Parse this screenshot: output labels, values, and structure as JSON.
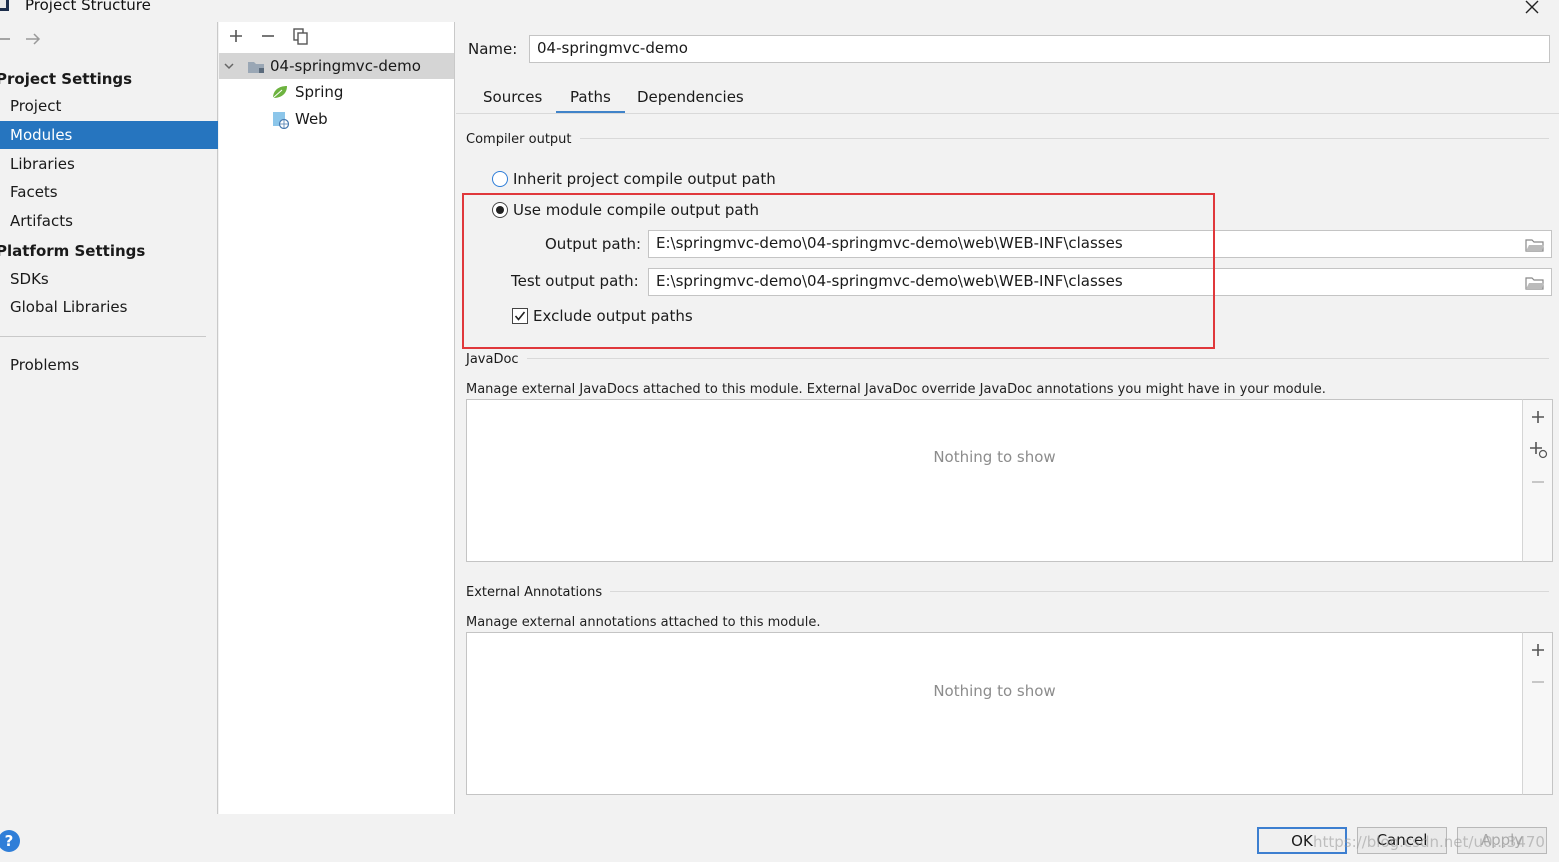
{
  "window": {
    "title": "Project Structure"
  },
  "colors": {
    "selection": "#2675bf",
    "tab_underline": "#4083c9",
    "highlight_box": "#e0383b",
    "spring_leaf": "#6db33f"
  },
  "icons": [
    "app-icon",
    "close-icon",
    "back-arrow-icon",
    "forward-arrow-icon",
    "add-icon",
    "remove-icon",
    "copy-icon",
    "chevron-down-icon",
    "module-folder-icon",
    "spring-icon",
    "web-icon",
    "folder-icon",
    "add-module-icon",
    "help-icon"
  ],
  "left_panel": {
    "project_settings_heading": "Project Settings",
    "project_items": [
      "Project",
      "Modules",
      "Libraries",
      "Facets",
      "Artifacts"
    ],
    "selected_item": "Modules",
    "platform_settings_heading": "Platform Settings",
    "platform_items": [
      "SDKs",
      "Global Libraries"
    ],
    "problems": "Problems"
  },
  "tree": {
    "root": "04-springmvc-demo",
    "children": [
      "Spring",
      "Web"
    ]
  },
  "detail": {
    "name_label": "Name:",
    "name_value": "04-springmvc-demo",
    "tabs": [
      "Sources",
      "Paths",
      "Dependencies"
    ],
    "active_tab": "Paths",
    "compiler_output": {
      "title": "Compiler output",
      "inherit_label": "Inherit project compile output path",
      "use_module_label": "Use module compile output path",
      "selected": "Use module compile output path",
      "output_path_label": "Output path:",
      "output_path_value": "E:\\springmvc-demo\\04-springmvc-demo\\web\\WEB-INF\\classes",
      "test_output_path_label": "Test output path:",
      "test_output_path_value": "E:\\springmvc-demo\\04-springmvc-demo\\web\\WEB-INF\\classes",
      "exclude_label": "Exclude output paths",
      "exclude_checked": true
    },
    "javadoc": {
      "title": "JavaDoc",
      "description": "Manage external JavaDocs attached to this module. External JavaDoc override JavaDoc annotations you might have in your module.",
      "empty_text": "Nothing to show"
    },
    "external_annotations": {
      "title": "External Annotations",
      "description": "Manage external annotations attached to this module.",
      "empty_text": "Nothing to show"
    }
  },
  "buttons": {
    "ok": "OK",
    "cancel": "Cancel",
    "apply": "Apply",
    "help": "?"
  },
  "watermark": "https://blog.csdn.net/u0...3470"
}
